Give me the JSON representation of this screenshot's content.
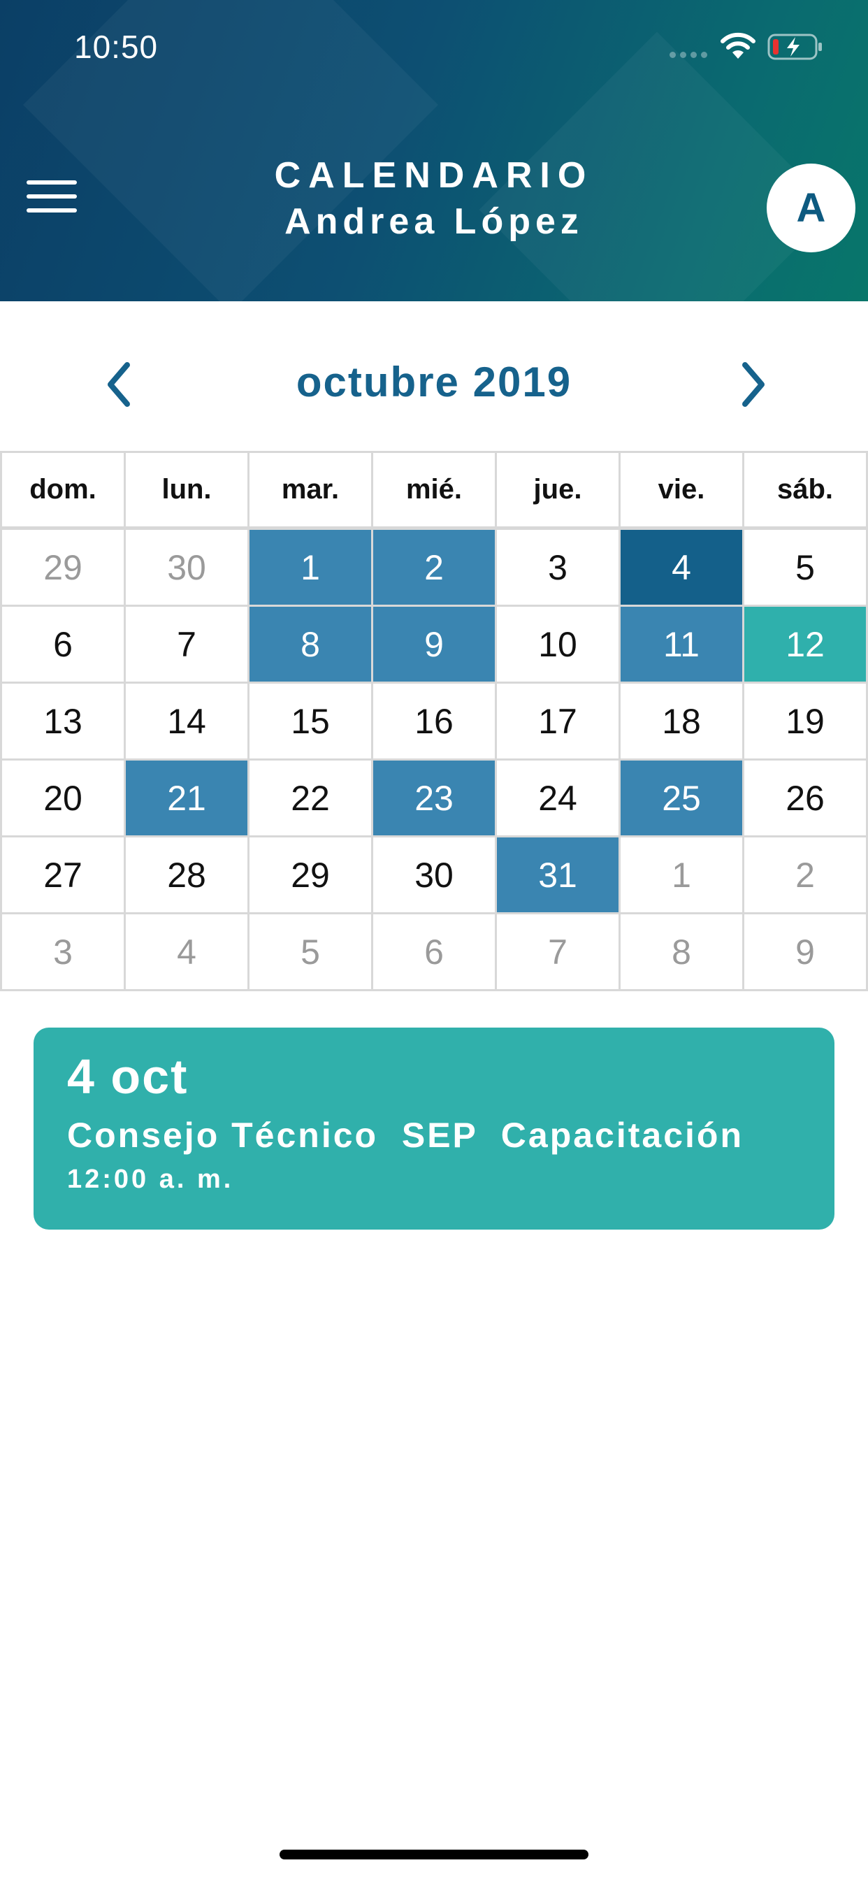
{
  "status_bar": {
    "time": "10:50"
  },
  "header": {
    "title": "CALENDARIO",
    "user_name": "Andrea López",
    "avatar_initial": "A",
    "menu_icon": "hamburger-menu-icon",
    "colors": {
      "gradient_start": "#0b3f66",
      "gradient_end": "#08766a"
    }
  },
  "month_nav": {
    "label": "octubre 2019",
    "prev_icon": "chevron-left-icon",
    "next_icon": "chevron-right-icon",
    "color": "#16628c"
  },
  "calendar": {
    "weekdays": [
      "dom.",
      "lun.",
      "mar.",
      "mié.",
      "jue.",
      "vie.",
      "sáb."
    ],
    "weeks": [
      [
        {
          "d": "29",
          "s": "outside"
        },
        {
          "d": "30",
          "s": "outside"
        },
        {
          "d": "1",
          "s": "event"
        },
        {
          "d": "2",
          "s": "event"
        },
        {
          "d": "3",
          "s": "normal"
        },
        {
          "d": "4",
          "s": "selected"
        },
        {
          "d": "5",
          "s": "normal"
        }
      ],
      [
        {
          "d": "6",
          "s": "normal"
        },
        {
          "d": "7",
          "s": "normal"
        },
        {
          "d": "8",
          "s": "event"
        },
        {
          "d": "9",
          "s": "event"
        },
        {
          "d": "10",
          "s": "normal"
        },
        {
          "d": "11",
          "s": "event"
        },
        {
          "d": "12",
          "s": "today"
        }
      ],
      [
        {
          "d": "13",
          "s": "normal"
        },
        {
          "d": "14",
          "s": "normal"
        },
        {
          "d": "15",
          "s": "normal"
        },
        {
          "d": "16",
          "s": "normal"
        },
        {
          "d": "17",
          "s": "normal"
        },
        {
          "d": "18",
          "s": "normal"
        },
        {
          "d": "19",
          "s": "normal"
        }
      ],
      [
        {
          "d": "20",
          "s": "normal"
        },
        {
          "d": "21",
          "s": "event"
        },
        {
          "d": "22",
          "s": "normal"
        },
        {
          "d": "23",
          "s": "event"
        },
        {
          "d": "24",
          "s": "normal"
        },
        {
          "d": "25",
          "s": "event"
        },
        {
          "d": "26",
          "s": "normal"
        }
      ],
      [
        {
          "d": "27",
          "s": "normal"
        },
        {
          "d": "28",
          "s": "normal"
        },
        {
          "d": "29",
          "s": "normal"
        },
        {
          "d": "30",
          "s": "normal"
        },
        {
          "d": "31",
          "s": "event"
        },
        {
          "d": "1",
          "s": "outside"
        },
        {
          "d": "2",
          "s": "outside"
        }
      ],
      [
        {
          "d": "3",
          "s": "outside"
        },
        {
          "d": "4",
          "s": "outside"
        },
        {
          "d": "5",
          "s": "outside"
        },
        {
          "d": "6",
          "s": "outside"
        },
        {
          "d": "7",
          "s": "outside"
        },
        {
          "d": "8",
          "s": "outside"
        },
        {
          "d": "9",
          "s": "outside"
        }
      ]
    ],
    "colors": {
      "event": "#3a85b1",
      "selected": "#14608a",
      "today": "#2fb0ac"
    }
  },
  "event_card": {
    "date": "4 oct",
    "title": "Consejo Técnico  SEP  Capacitación",
    "time": "12:00 a. m.",
    "color": "#30b0ab"
  }
}
